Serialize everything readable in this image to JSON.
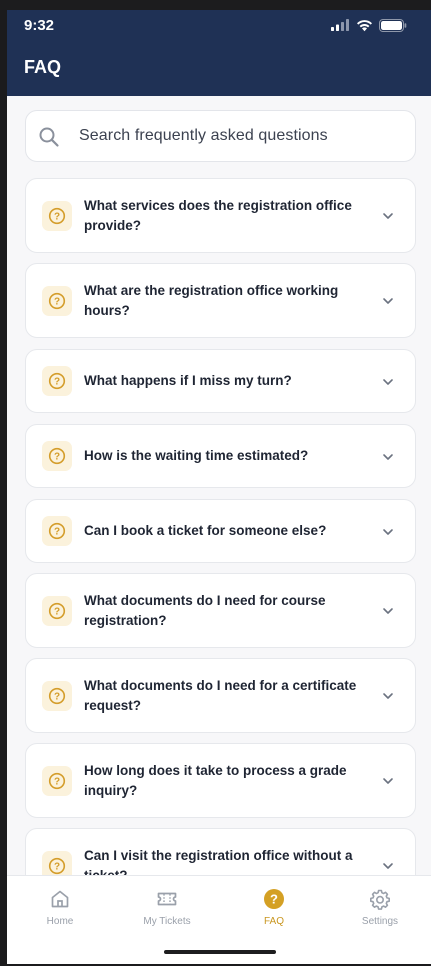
{
  "status_bar": {
    "time": "9:32"
  },
  "header": {
    "title": "FAQ"
  },
  "search": {
    "placeholder": "Search frequently asked questions"
  },
  "faq": [
    {
      "question": "What services does the registration office provide?"
    },
    {
      "question": "What are the registration office working hours?"
    },
    {
      "question": "What happens if I miss my turn?"
    },
    {
      "question": "How is the waiting time estimated?"
    },
    {
      "question": "Can I book a ticket for someone else?"
    },
    {
      "question": "What documents do I need for course registration?"
    },
    {
      "question": "What documents do I need for a certificate request?"
    },
    {
      "question": "How long does it take to process a grade inquiry?"
    },
    {
      "question": "Can I visit the registration office without a ticket?"
    }
  ],
  "tabs": [
    {
      "label": "Home",
      "icon": "home-icon",
      "active": false
    },
    {
      "label": "My Tickets",
      "icon": "ticket-icon",
      "active": false
    },
    {
      "label": "FAQ",
      "icon": "help-circle-icon",
      "active": true
    },
    {
      "label": "Settings",
      "icon": "gear-icon",
      "active": false
    }
  ],
  "colors": {
    "header": "#1f3155",
    "accent": "#c9961f",
    "badge_bg": "#fbf2dc"
  }
}
